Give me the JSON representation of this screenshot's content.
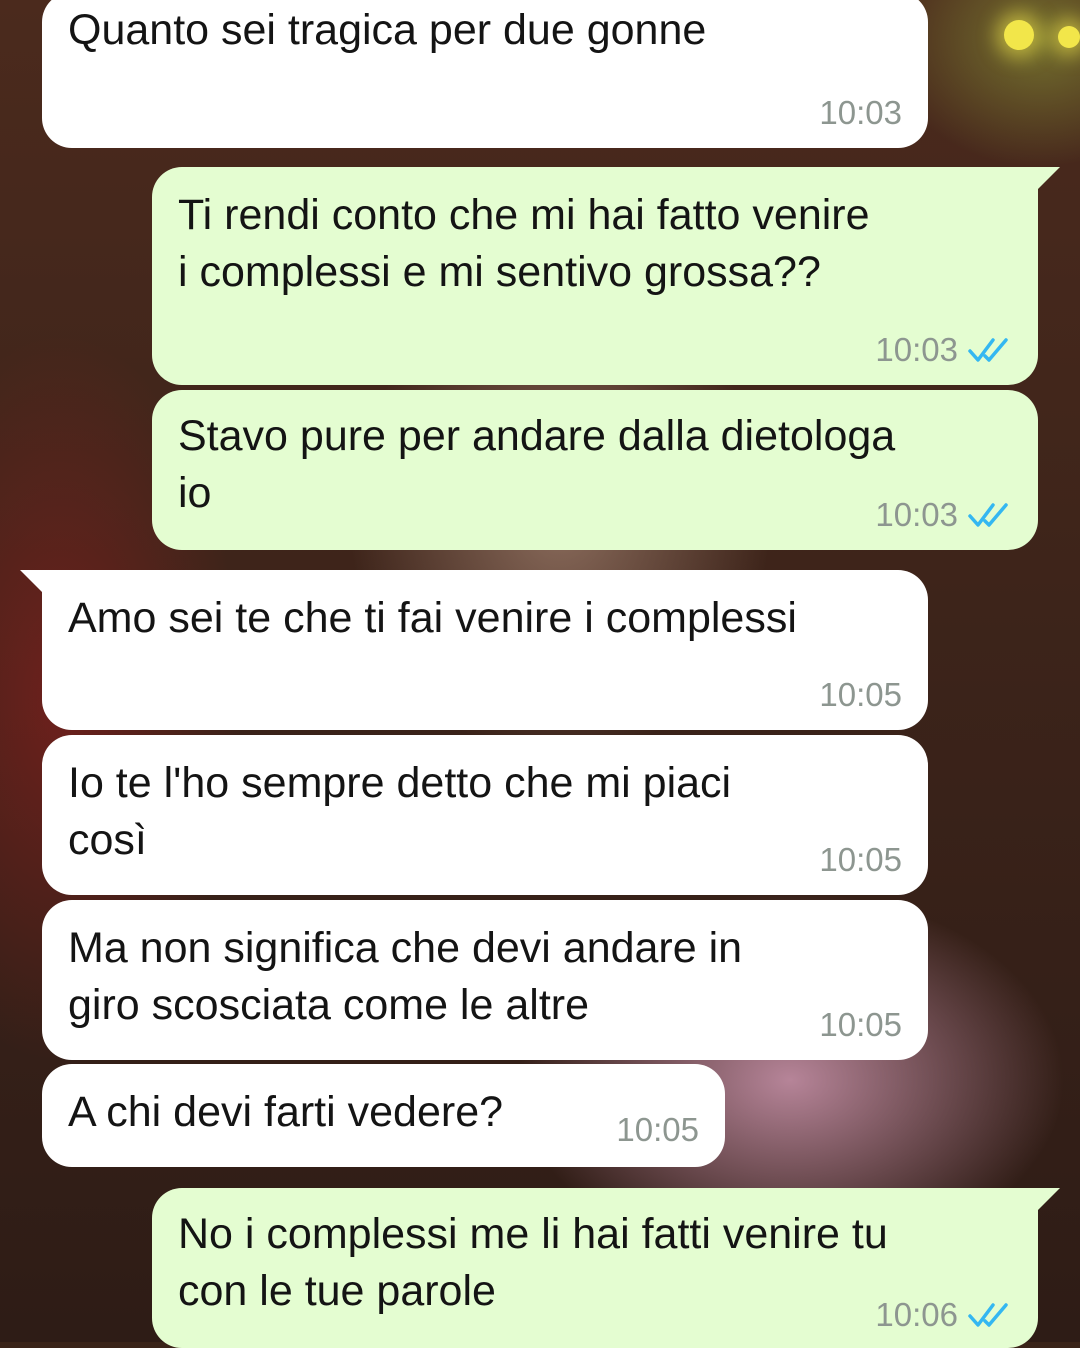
{
  "chat": {
    "messages": [
      {
        "text": "Quanto sei tragica per due gonne",
        "time": "10:03",
        "direction": "in"
      },
      {
        "text": "Ti rendi conto che mi hai fatto venire\ni complessi e mi sentivo grossa??",
        "time": "10:03",
        "direction": "out",
        "status": "read"
      },
      {
        "text": "Stavo pure per andare dalla dietologa\nio",
        "time": "10:03",
        "direction": "out",
        "status": "read"
      },
      {
        "text": "Amo sei te che ti fai venire i complessi",
        "time": "10:05",
        "direction": "in"
      },
      {
        "text": "Io te l'ho sempre detto che mi piaci\ncosì",
        "time": "10:05",
        "direction": "in"
      },
      {
        "text": "Ma non significa che devi andare in\ngiro scosciata come le altre",
        "time": "10:05",
        "direction": "in"
      },
      {
        "text": "A chi devi farti vedere?",
        "time": "10:05",
        "direction": "in"
      },
      {
        "text": "No i complessi me li hai fatti venire tu\ncon le tue parole",
        "time": "10:06",
        "direction": "out",
        "status": "read"
      }
    ]
  },
  "colors": {
    "incoming_bubble": "#ffffff",
    "outgoing_bubble": "#e4fdd1",
    "timestamp": "#8d9690",
    "read_ticks": "#34b7f1"
  },
  "icons": {
    "read_receipt": "double-check-icon"
  }
}
